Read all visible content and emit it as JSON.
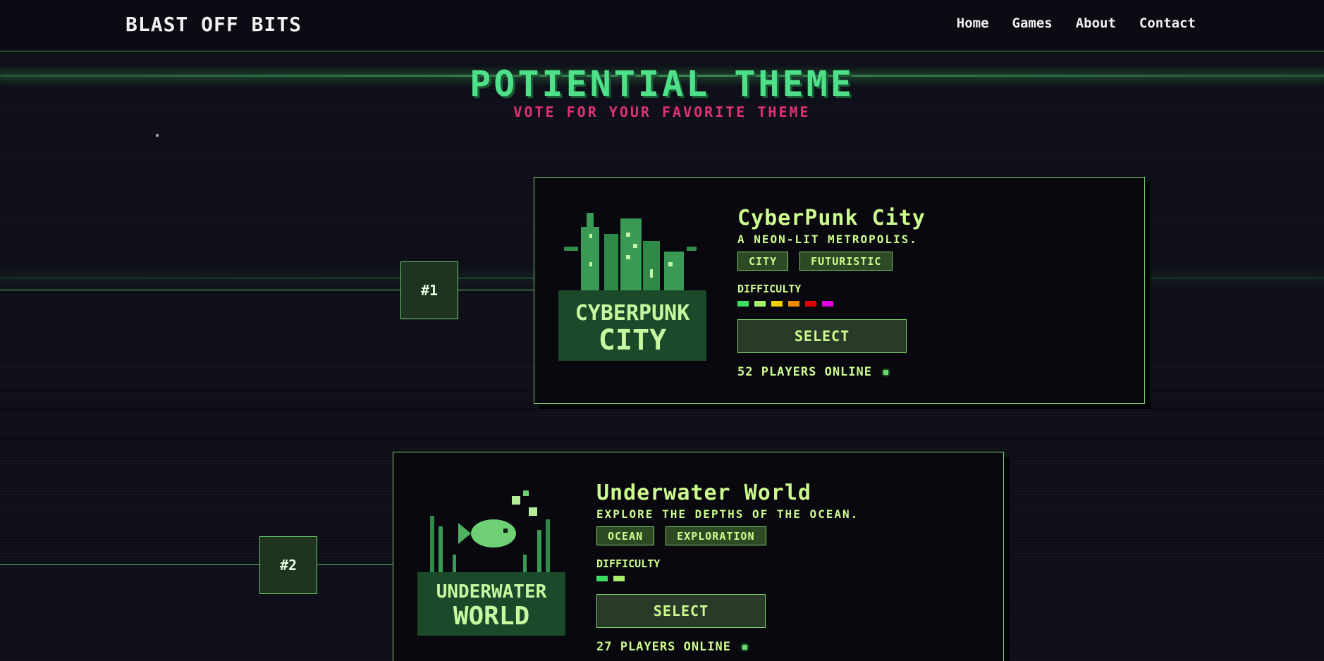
{
  "brand": "BLAST OFF BITS",
  "nav": [
    "Home",
    "Games",
    "About",
    "Contact"
  ],
  "hero": {
    "title": "POTIENTIAL THEME",
    "subtitle": "VOTE FOR YOUR FAVORITE THEME"
  },
  "themes": [
    {
      "rank": "#1",
      "title": "CyberPunk City",
      "art_text": [
        "CYBERPUNK",
        "CITY"
      ],
      "description": "A NEON-LIT METROPOLIS.",
      "tags": [
        "CITY",
        "FUTURISTIC"
      ],
      "difficulty_label": "DIFFICULTY",
      "difficulty_level": 6,
      "difficulty_colors": [
        "#3ddc63",
        "#a6f06a",
        "#f0d000",
        "#f08a00",
        "#e00000",
        "#e000e0"
      ],
      "select_label": "SELECT",
      "players_online": "52 PLAYERS ONLINE"
    },
    {
      "rank": "#2",
      "title": "Underwater World",
      "art_text": [
        "UNDERWATER",
        "WORLD"
      ],
      "description": "EXPLORE THE DEPTHS OF THE OCEAN.",
      "tags": [
        "OCEAN",
        "EXPLORATION"
      ],
      "difficulty_label": "DIFFICULTY",
      "difficulty_level": 2,
      "difficulty_colors": [
        "#3ddc63",
        "#a6f06a"
      ],
      "select_label": "SELECT",
      "players_online": "27 PLAYERS ONLINE"
    }
  ],
  "colors": {
    "accent_green": "#4fe08a",
    "subtitle_pink": "#e0307a",
    "card_text": "#cdfc8e",
    "border_green": "#7fd06e"
  }
}
